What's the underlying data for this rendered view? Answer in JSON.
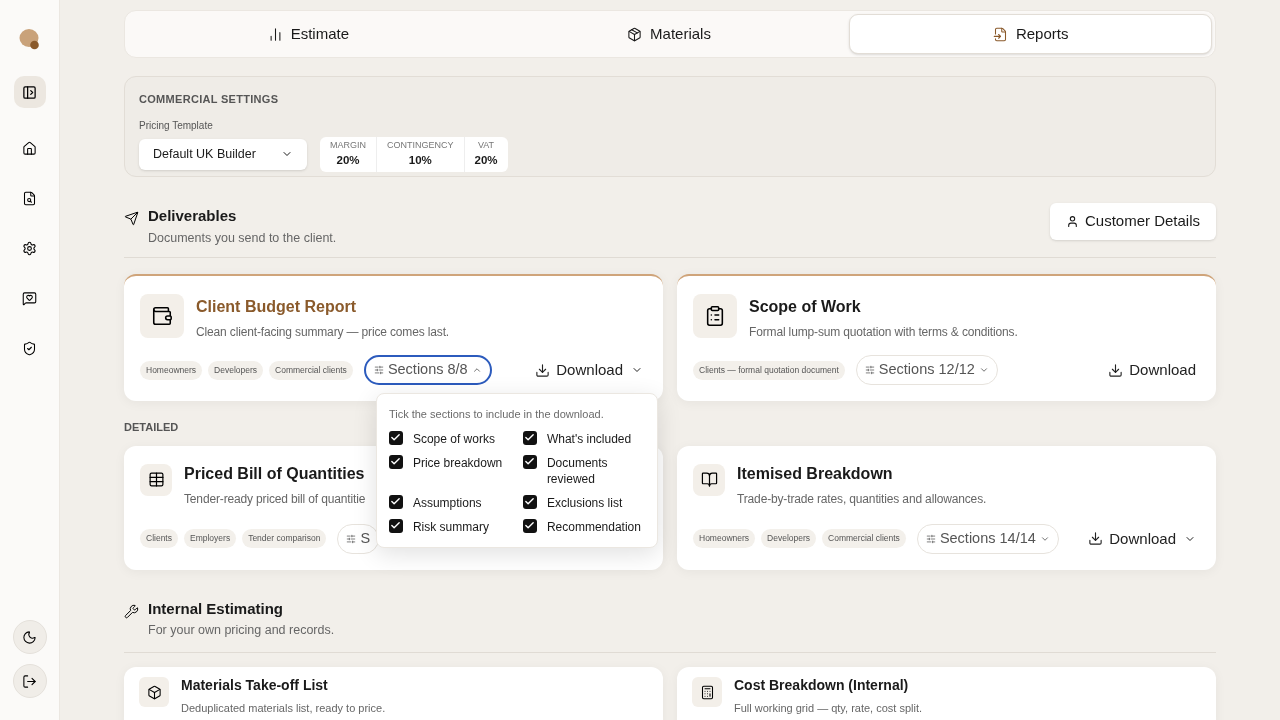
{
  "sidebar": {
    "items": [
      {
        "kind": "home",
        "selected": false
      },
      {
        "kind": "file-search",
        "selected": false
      },
      {
        "kind": "settings",
        "selected": false
      },
      {
        "kind": "message",
        "selected": false
      },
      {
        "kind": "shield",
        "selected": false
      }
    ],
    "bottom": [
      {
        "kind": "moon"
      },
      {
        "kind": "logout"
      }
    ]
  },
  "tabs": [
    {
      "label": "Estimate",
      "kind": "chart",
      "selected": false
    },
    {
      "label": "Materials",
      "kind": "package",
      "selected": false
    },
    {
      "label": "Reports",
      "kind": "file",
      "selected": true
    }
  ],
  "commercial_settings": {
    "title": "COMMERCIAL SETTINGS",
    "template_label": "Pricing Template",
    "template_value": "Default UK Builder",
    "stats": [
      {
        "label": "MARGIN",
        "value": "20%"
      },
      {
        "label": "CONTINGENCY",
        "value": "10%"
      },
      {
        "label": "VAT",
        "value": "20%"
      }
    ]
  },
  "deliverables": {
    "title": "Deliverables",
    "subtitle": "Documents you send to the client.",
    "button": "Customer Details",
    "featured": [
      {
        "kind": "wallet",
        "title": "Client Budget Report",
        "description": "Clean client-facing summary — price comes last.",
        "active": true,
        "tags": [
          "Homeowners",
          "Developers",
          "Commercial clients"
        ],
        "sections": {
          "label": "Sections 8/8",
          "open": true
        },
        "download": {
          "label": "Download",
          "has_menu": true
        }
      },
      {
        "kind": "clipboard",
        "title": "Scope of Work",
        "description": "Formal lump-sum quotation with terms & conditions.",
        "active": false,
        "tags": [
          "Clients — formal quotation document"
        ],
        "sections": {
          "label": "Sections 12/12",
          "open": false
        },
        "download": {
          "label": "Download",
          "has_menu": false
        }
      }
    ],
    "detailed_label": "DETAILED",
    "detailed": [
      {
        "kind": "table",
        "title": "Priced Bill of Quantities",
        "description": "Tender-ready priced bill of quantitie",
        "active": false,
        "tags": [
          "Clients",
          "Employers",
          "Tender comparison"
        ],
        "sections": {
          "label": "S",
          "open": false
        }
      },
      {
        "kind": "book",
        "title": "Itemised Breakdown",
        "description": "Trade-by-trade rates, quantities and allowances.",
        "active": false,
        "tags": [
          "Homeowners",
          "Developers",
          "Commercial clients"
        ],
        "sections": {
          "label": "Sections 14/14",
          "open": false
        },
        "download": {
          "label": "Download",
          "has_menu": true
        }
      }
    ]
  },
  "sections_popover": {
    "hint": "Tick the sections to include in the download.",
    "options": [
      {
        "label": "Scope of works",
        "checked": true
      },
      {
        "label": "What's included",
        "checked": true
      },
      {
        "label": "Price breakdown",
        "checked": true
      },
      {
        "label": "Documents reviewed",
        "checked": true
      },
      {
        "label": "Assumptions",
        "checked": true
      },
      {
        "label": "Exclusions list",
        "checked": true
      },
      {
        "label": "Risk summary",
        "checked": true
      },
      {
        "label": "Recommendation",
        "checked": true
      }
    ]
  },
  "internal": {
    "title": "Internal Estimating",
    "subtitle": "For your own pricing and records.",
    "cards": [
      {
        "kind": "box",
        "title": "Materials Take-off List",
        "description": "Deduplicated materials list, ready to price."
      },
      {
        "kind": "calculator",
        "title": "Cost Breakdown (Internal)",
        "description": "Full working grid — qty, rate, cost split."
      }
    ]
  }
}
